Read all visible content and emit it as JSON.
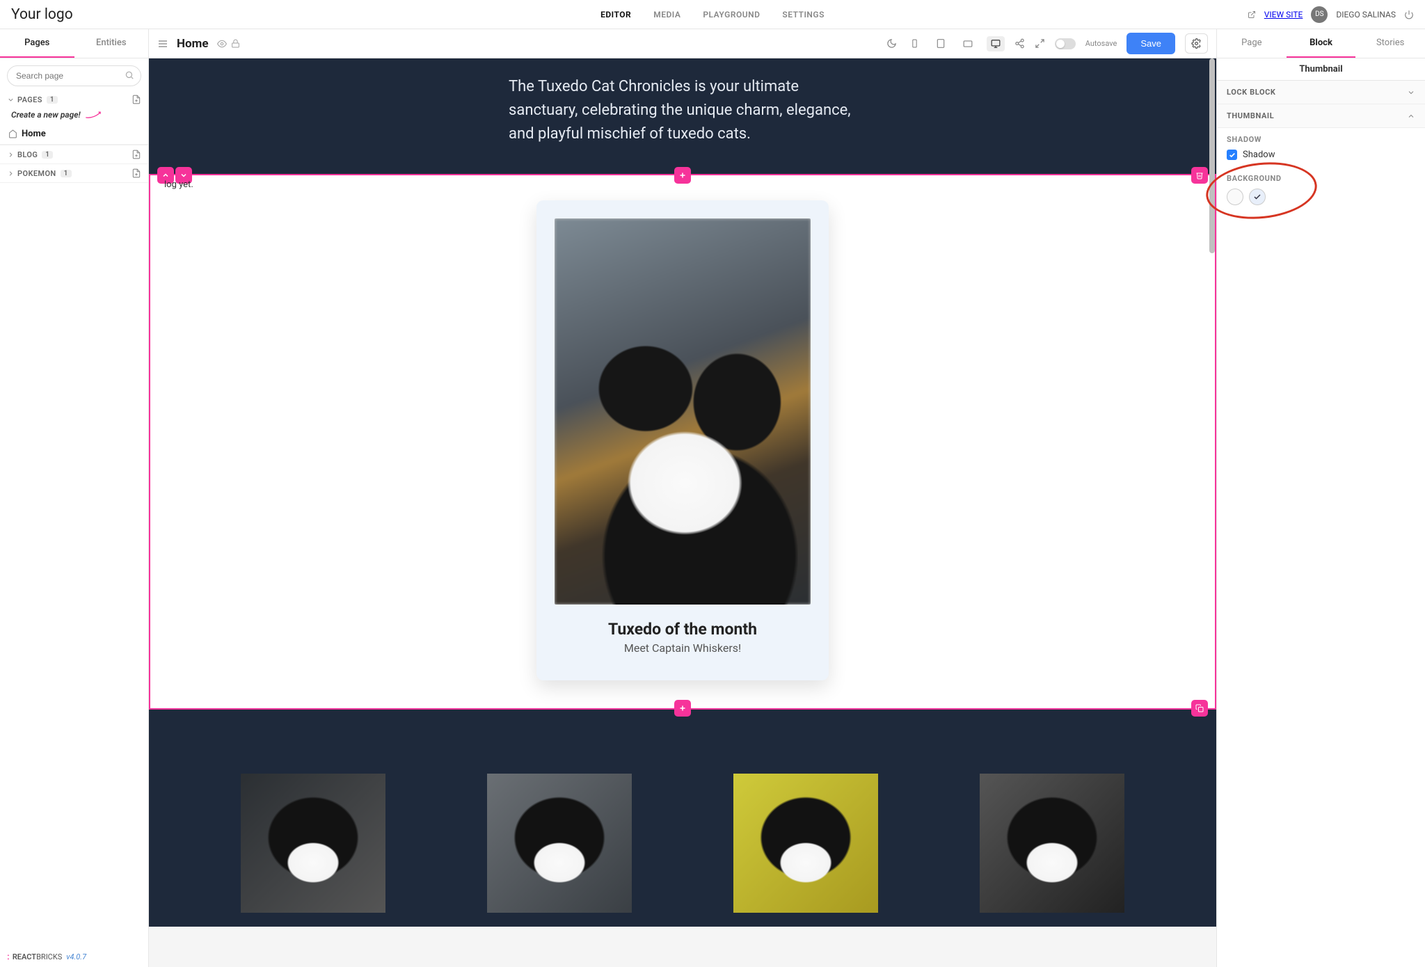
{
  "brand": {
    "logo": "Your logo"
  },
  "topnav": {
    "editor": "EDITOR",
    "media": "MEDIA",
    "playground": "PLAYGROUND",
    "settings": "SETTINGS"
  },
  "topright": {
    "view_site": "VIEW SITE",
    "user_initials": "DS",
    "user_name": "DIEGO SALINAS"
  },
  "lefttabs": {
    "pages": "Pages",
    "entities": "Entities"
  },
  "search": {
    "placeholder": "Search page"
  },
  "tree": {
    "pages": {
      "label": "PAGES",
      "count": "1",
      "create": "Create a new page!",
      "home": "Home"
    },
    "blog": {
      "label": "BLOG",
      "count": "1"
    },
    "pokemon": {
      "label": "POKEMON",
      "count": "1"
    }
  },
  "toolbar": {
    "title": "Home",
    "autosave": "Autosave",
    "save": "Save"
  },
  "canvas": {
    "hero_text": "The Tuxedo Cat Chronicles is your ultimate sanctuary, celebrating the unique charm, elegance, and playful mischief of tuxedo cats.",
    "noblog_visible": "log yet.",
    "thumb_title": "Tuxedo of the month",
    "thumb_sub": "Meet Captain Whiskers!"
  },
  "righttabs": {
    "page": "Page",
    "block": "Block",
    "stories": "Stories"
  },
  "rightsub": "Thumbnail",
  "accordion": {
    "lock": "LOCK BLOCK",
    "thumbnail": "THUMBNAIL"
  },
  "props": {
    "shadow_group": "SHADOW",
    "shadow_label": "Shadow",
    "background_group": "BACKGROUND"
  },
  "footer": {
    "brand1": "REACT",
    "brand2": "BRICKS",
    "version": "v4.0.7"
  }
}
